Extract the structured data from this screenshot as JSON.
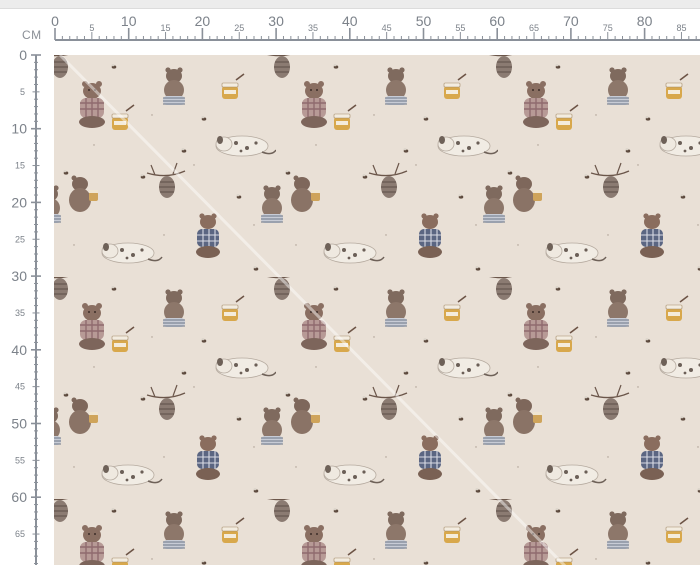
{
  "ruler": {
    "unit": "CM",
    "h_major_labels": [
      "0",
      "10",
      "20",
      "30",
      "40",
      "50",
      "60",
      "70",
      "80"
    ],
    "h_minor_labels": [
      "5",
      "15",
      "25",
      "35",
      "45",
      "55",
      "65",
      "75",
      "85"
    ],
    "v_major_labels": [
      "0",
      "10",
      "20",
      "30",
      "40",
      "50",
      "60"
    ],
    "v_minor_labels": [
      "5",
      "15",
      "25",
      "35",
      "45",
      "55",
      "65"
    ]
  },
  "fabric": {
    "background_color": "#e9e0d6",
    "motifs": [
      "bear-in-checkered-sweater-icon",
      "honey-pot-icon",
      "beehive-icon",
      "sleeping-dog-icon",
      "sitting-bear-icon",
      "bee-icon"
    ]
  },
  "colors": {
    "ruler_line": "#8a9099",
    "ruler_text": "#7c828a"
  }
}
